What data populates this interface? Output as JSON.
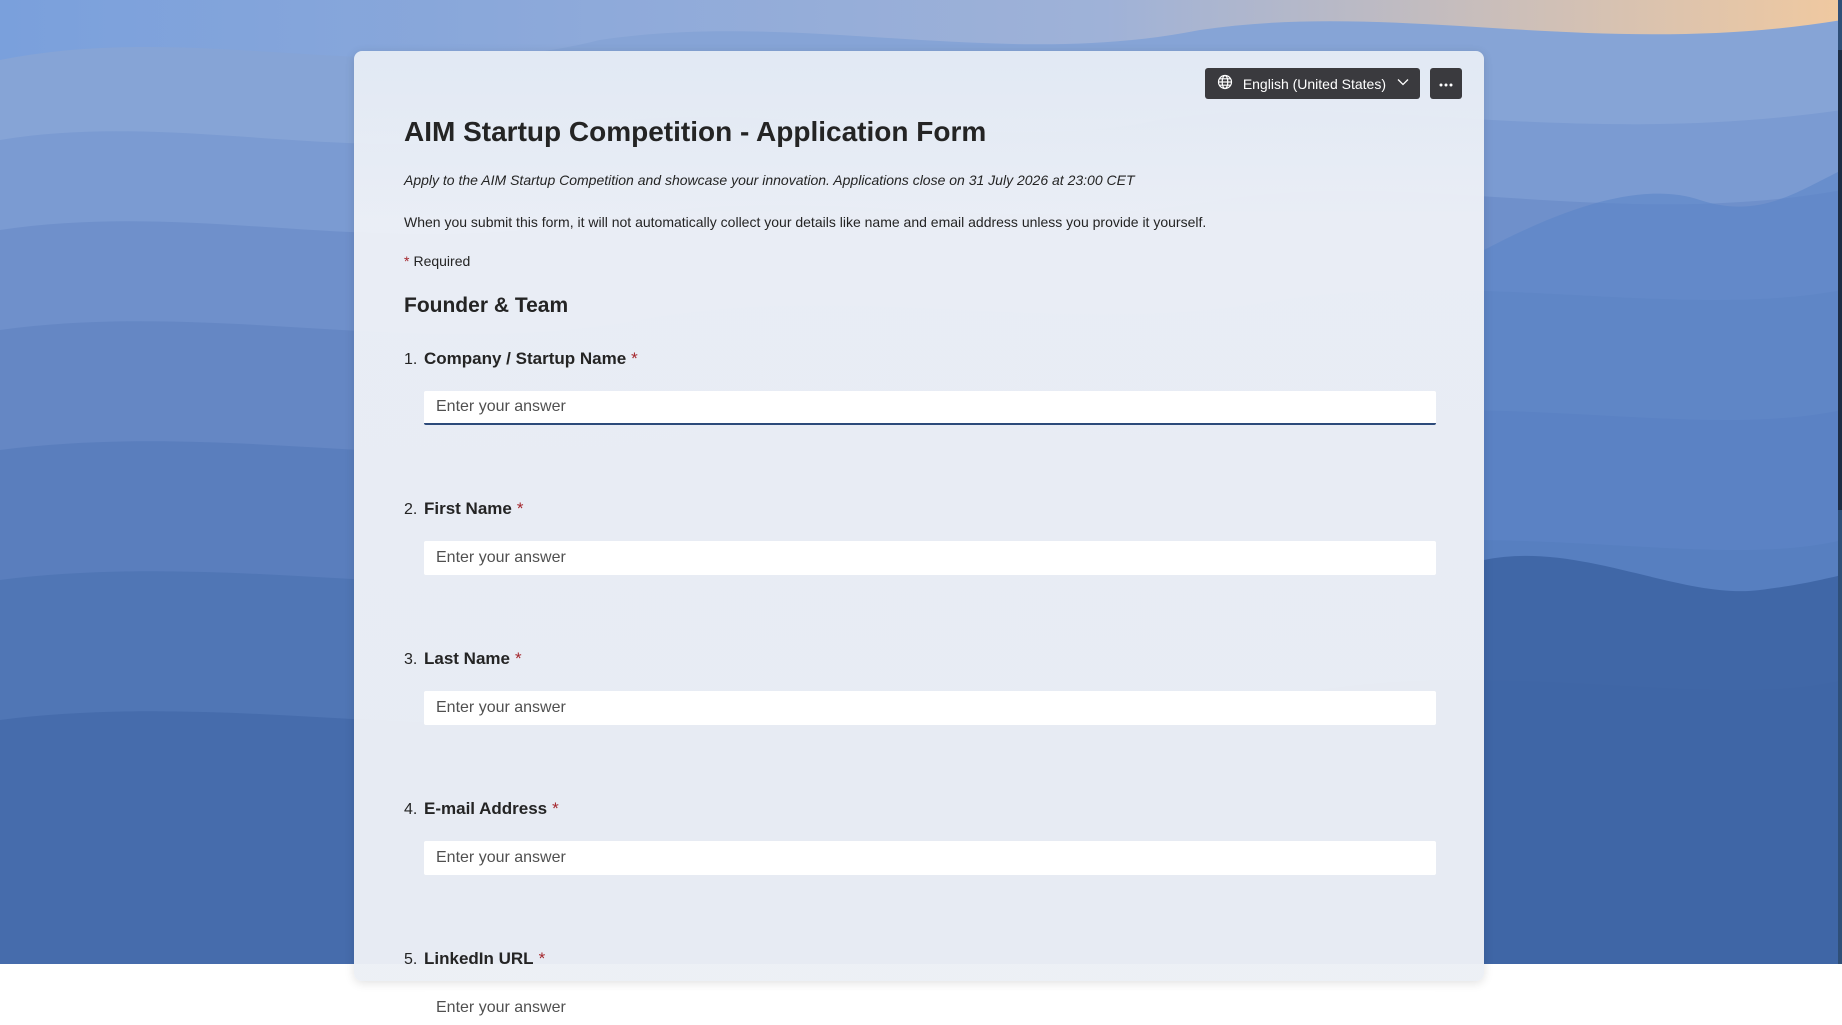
{
  "header": {
    "language_label": "English (United States)",
    "language_icon": "globe-icon",
    "more_icon": "more-horizontal-icon"
  },
  "form": {
    "title": "AIM Startup Competition - Application Form",
    "description": "Apply to the AIM Startup Competition and showcase your innovation. Applications close on 31 July 2026 at 23:00 CET",
    "privacy_note": "When you submit this form, it will not automatically collect your details like name and email address unless you provide it yourself.",
    "required_star": "*",
    "required_label": "Required",
    "section_title": "Founder & Team",
    "questions": [
      {
        "number": "1.",
        "label": "Company / Startup Name",
        "required": "*",
        "placeholder": "Enter your answer"
      },
      {
        "number": "2.",
        "label": "First Name",
        "required": "*",
        "placeholder": "Enter your answer"
      },
      {
        "number": "3.",
        "label": "Last Name",
        "required": "*",
        "placeholder": "Enter your answer"
      },
      {
        "number": "4.",
        "label": "E-mail Address",
        "required": "*",
        "placeholder": "Enter your answer"
      },
      {
        "number": "5.",
        "label": "LinkedIn URL",
        "required": "*",
        "placeholder": "Enter your answer"
      }
    ]
  },
  "colors": {
    "required_star": "#a4262c",
    "button_bg": "#3a3a3e",
    "focus_underline": "#2c4a7a"
  }
}
